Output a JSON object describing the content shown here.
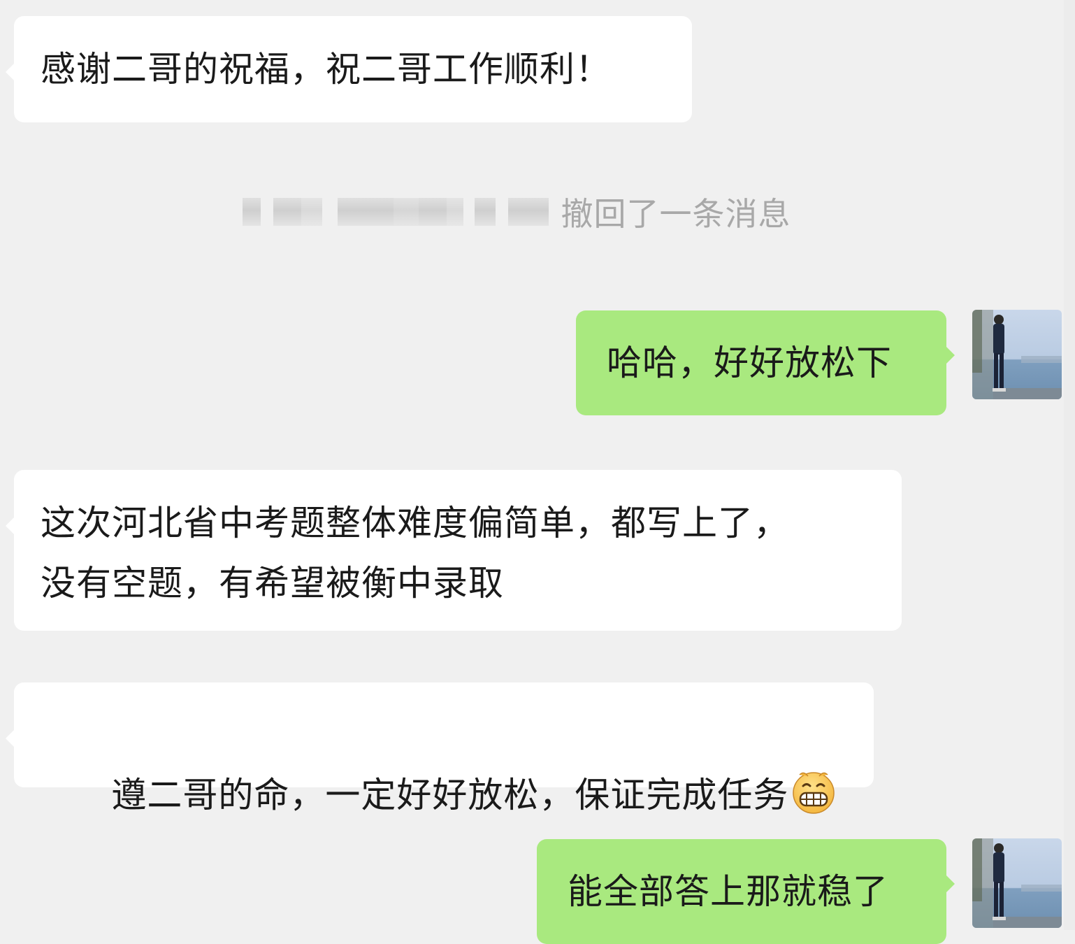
{
  "chat": {
    "messages": [
      {
        "side": "incoming",
        "text": "感谢二哥的祝福，祝二哥工作顺利！"
      },
      {
        "side": "system",
        "text": "撤回了一条消息"
      },
      {
        "side": "outgoing",
        "text": "哈哈，好好放松下"
      },
      {
        "side": "incoming",
        "text": "这次河北省中考题整体难度偏简单，都写上了，\n没有空题，有希望被衡中录取"
      },
      {
        "side": "incoming",
        "text": "遵二哥的命，一定好好放松，保证完成任务",
        "emoji": "grinning-face-emoji"
      },
      {
        "side": "outgoing",
        "text": "能全部答上那就稳了"
      }
    ]
  },
  "colors": {
    "background": "#f0f0f0",
    "incoming_bubble": "#ffffff",
    "outgoing_bubble": "#a9e97f",
    "system_text": "#a8a8a8",
    "message_text": "#1a1a1a"
  },
  "icons": {
    "avatar": "user-avatar-photo",
    "emoji": "grinning-face-emoji"
  }
}
